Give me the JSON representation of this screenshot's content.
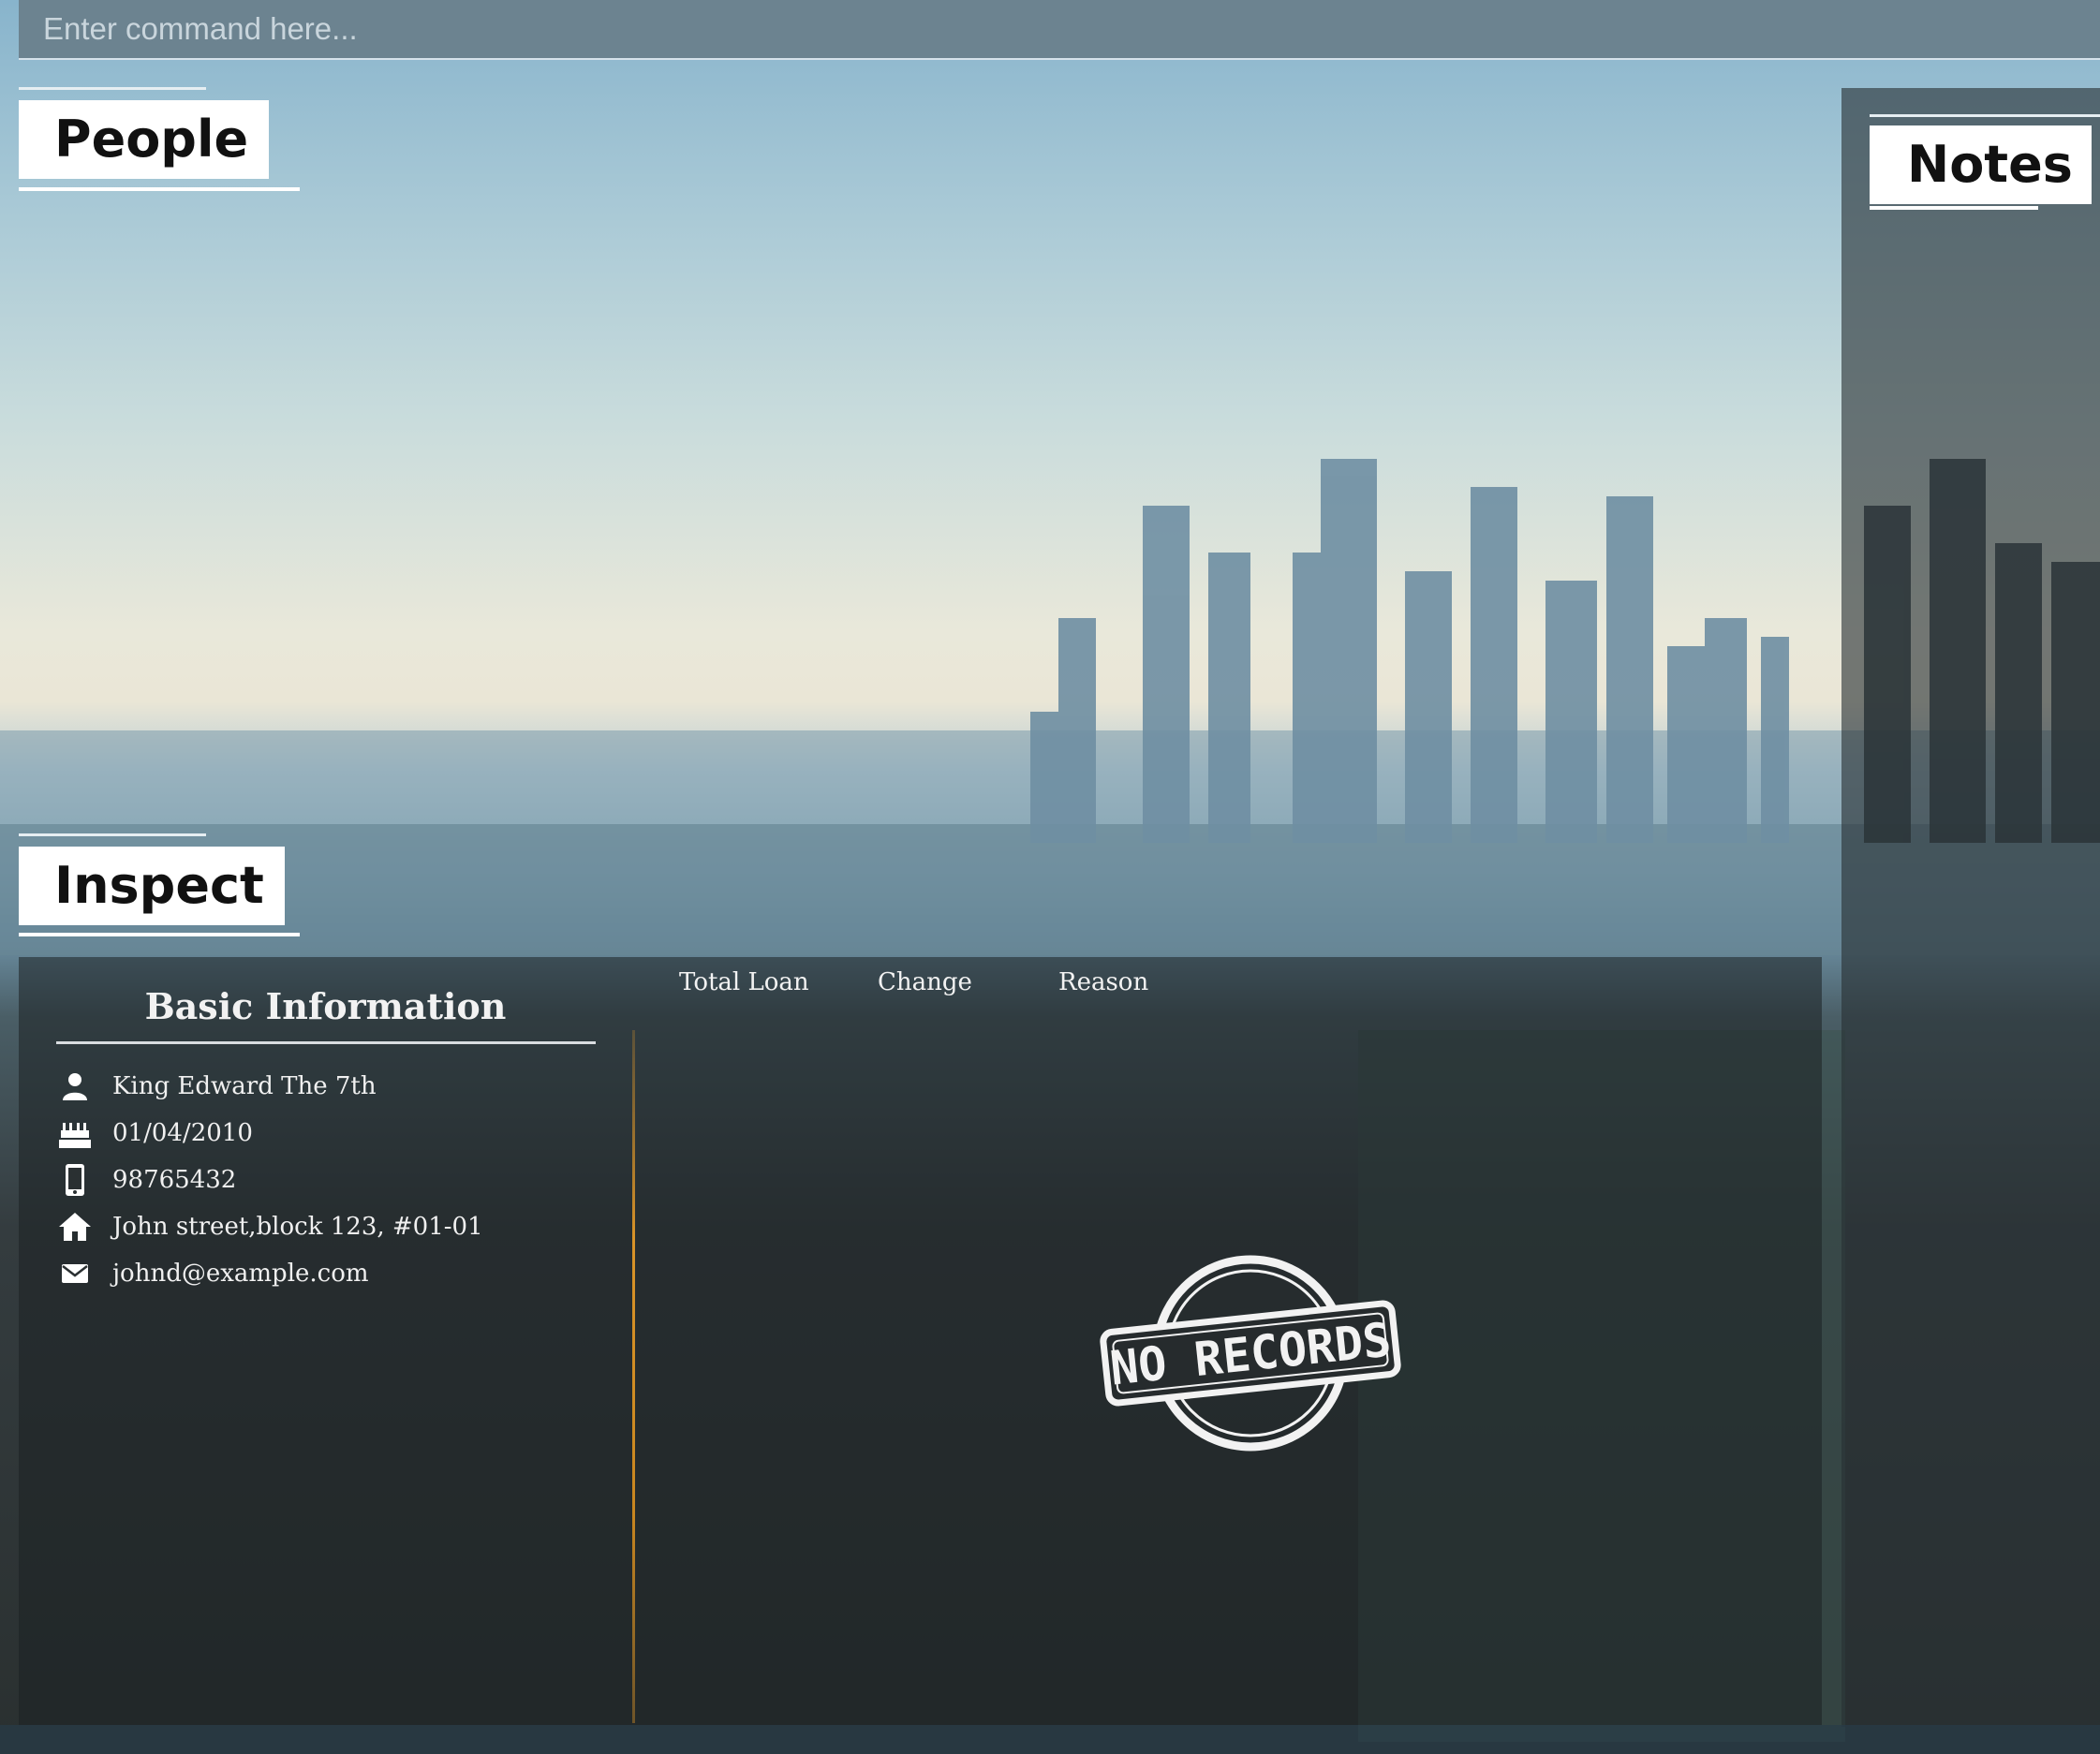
{
  "command_bar": {
    "placeholder": "Enter command here..."
  },
  "people": {
    "title": "People"
  },
  "notes": {
    "title": "Notes"
  },
  "inspect": {
    "title": "Inspect",
    "basic_info": {
      "heading": "Basic Information",
      "name": "King Edward The 7th",
      "birthday": "01/04/2010",
      "phone": "98765432",
      "address": "John street,block 123, #01-01",
      "email": "johnd@example.com"
    },
    "loan_table": {
      "columns": [
        "Total Loan",
        "Change",
        "Reason"
      ],
      "empty_stamp": "NO RECORDS"
    }
  },
  "icons": {
    "name": "person-icon",
    "birthday": "cake-icon",
    "phone": "phone-icon",
    "address": "home-icon",
    "email": "mail-icon"
  }
}
